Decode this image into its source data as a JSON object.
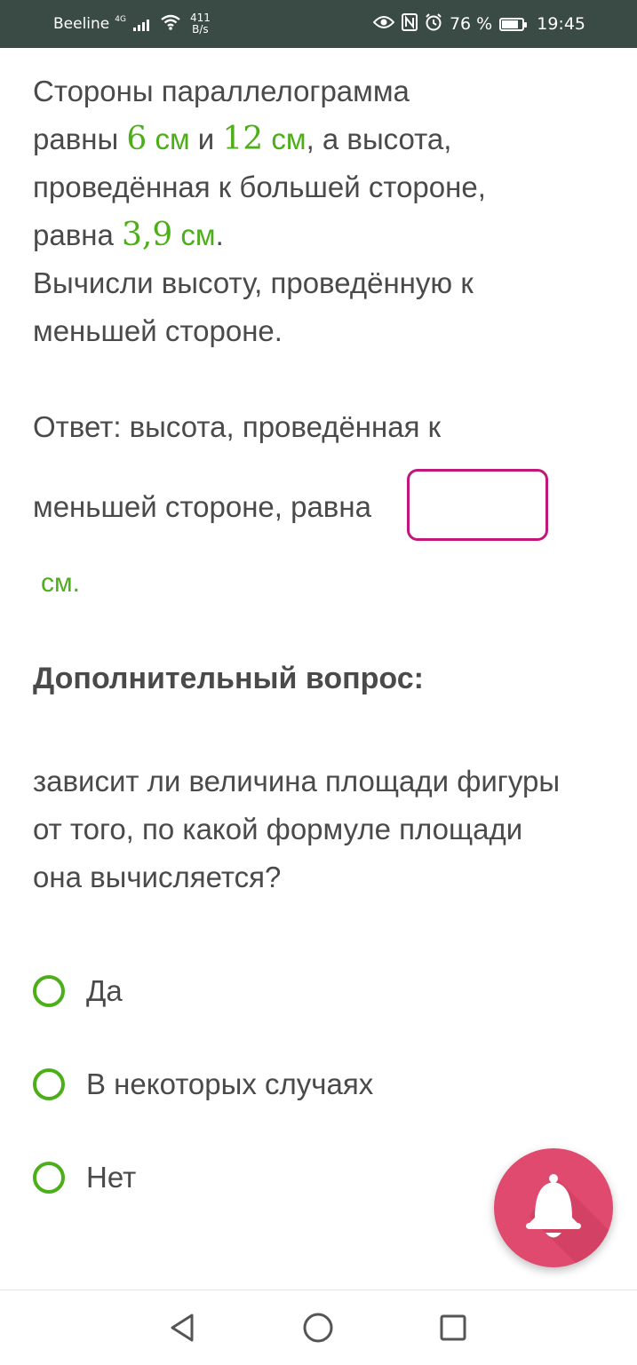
{
  "status_bar": {
    "carrier": "Beeline",
    "network": "4G",
    "speed_value": "411",
    "speed_unit": "B/s",
    "battery": "76 %",
    "time": "19:45"
  },
  "question": {
    "line1": "Стороны параллелограмма",
    "p_ravny": "равны ",
    "side1": "6",
    "unit_cm": "см",
    "and": " и ",
    "side2": "12",
    "after_side2": ", а высота,",
    "line3": "проведённая к большей стороне,",
    "p_ravna": "равна ",
    "height": "3,9",
    "period": ".",
    "line5": "Вычисли высоту, проведённую к",
    "line6": "меньшей стороне."
  },
  "answer": {
    "label_line1": "Ответ: высота, проведённая к",
    "label_line2": "меньшей стороне, равна",
    "input_value": "",
    "unit": "см."
  },
  "extra": {
    "heading": "Дополнительный вопрос:",
    "question_line1": "зависит ли величина площади фигуры",
    "question_line2": "от того, по какой формуле площади",
    "question_line3": "она вычисляется?",
    "options": [
      {
        "label": "Да"
      },
      {
        "label": "В некоторых случаях"
      },
      {
        "label": "Нет"
      }
    ]
  },
  "colors": {
    "accent_green": "#4caf1a",
    "input_border": "#c2177a",
    "fab": "#e04a6e",
    "status_bar": "#3a4a44"
  },
  "icons": [
    "eye-icon",
    "nfc-icon",
    "alarm-icon",
    "battery-icon",
    "bell-icon",
    "back-nav-icon",
    "home-nav-icon",
    "recents-nav-icon"
  ]
}
